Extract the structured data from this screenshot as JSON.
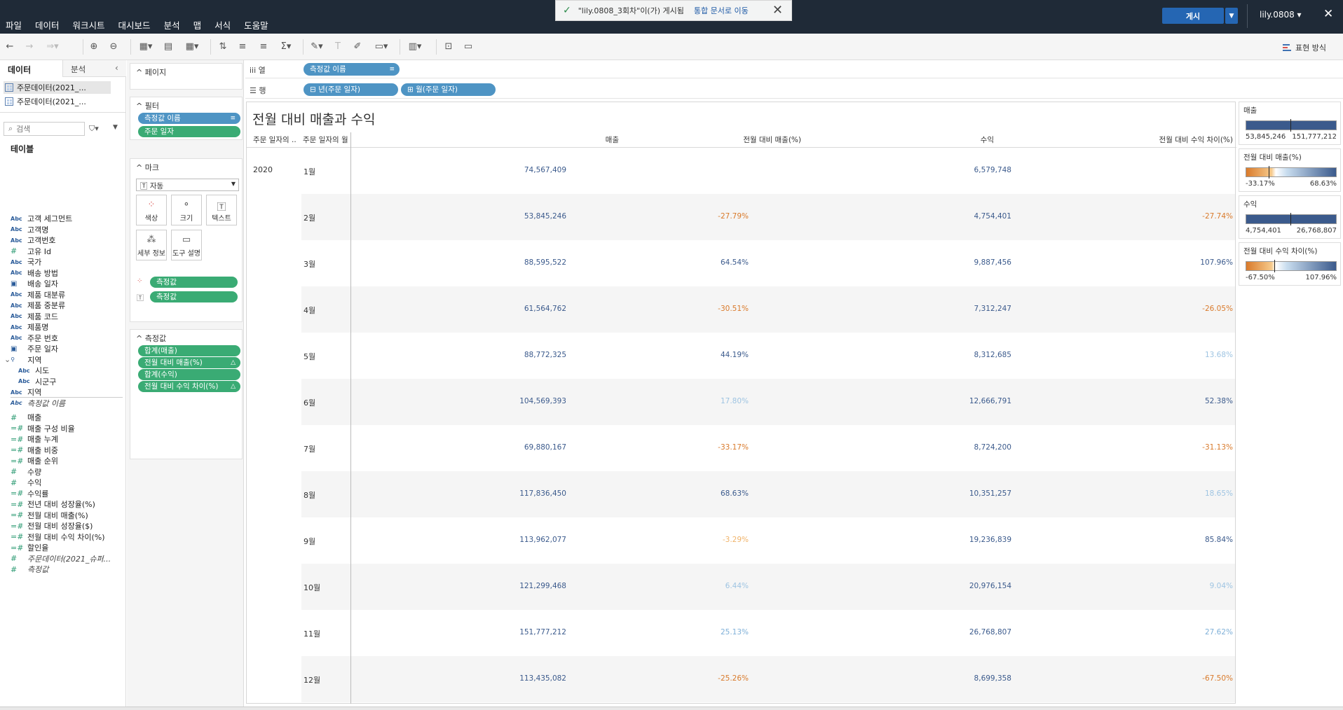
{
  "menu": [
    "파일",
    "데이터",
    "워크시트",
    "대시보드",
    "분석",
    "맵",
    "서식",
    "도움말"
  ],
  "toast": {
    "message": "\"lily.0808_3회차\"이(가) 게시됨",
    "link": "통합 문서로 이동"
  },
  "publish_label": "게시",
  "user": "lily.0808 ▾",
  "show_me": "표현 방식",
  "data_pane": {
    "tab_data": "데이터",
    "tab_analysis": "분석",
    "datasources": [
      "주문데이터(2021_...",
      "주문데이터(2021_..."
    ],
    "search_placeholder": "검색",
    "tables_heading": "테이블",
    "dimensions": [
      {
        "icon": "Abc",
        "name": "고객 세그먼트"
      },
      {
        "icon": "Abc",
        "name": "고객명"
      },
      {
        "icon": "Abc",
        "name": "고객번호"
      },
      {
        "icon": "#",
        "name": "고유 Id"
      },
      {
        "icon": "Abc",
        "name": "국가"
      },
      {
        "icon": "Abc",
        "name": "배송 방법"
      },
      {
        "icon": "cal",
        "name": "배송 일자"
      },
      {
        "icon": "Abc",
        "name": "제품 대분류"
      },
      {
        "icon": "Abc",
        "name": "제품 중분류"
      },
      {
        "icon": "Abc",
        "name": "제품 코드"
      },
      {
        "icon": "Abc",
        "name": "제품명"
      },
      {
        "icon": "Abc",
        "name": "주문 번호"
      },
      {
        "icon": "cal",
        "name": "주문 일자"
      }
    ],
    "hierarchy": "지역",
    "hierarchy_children": [
      "시도",
      "시군구"
    ],
    "dimensions_after": [
      {
        "icon": "Abc",
        "name": "지역"
      },
      {
        "icon": "Abc",
        "name": "측정값 이름"
      }
    ],
    "measures": [
      {
        "icon": "#",
        "name": "매출"
      },
      {
        "icon": "=#",
        "name": "매출 구성 비율"
      },
      {
        "icon": "=#",
        "name": "매출 누계"
      },
      {
        "icon": "=#",
        "name": "매출 비중"
      },
      {
        "icon": "=#",
        "name": "매출 순위"
      },
      {
        "icon": "#",
        "name": "수량"
      },
      {
        "icon": "#",
        "name": "수익"
      },
      {
        "icon": "=#",
        "name": "수익률"
      },
      {
        "icon": "=#",
        "name": "전년 대비 성장율(%)"
      },
      {
        "icon": "=#",
        "name": "전월 대비 매출(%)"
      },
      {
        "icon": "=#",
        "name": "전월 대비 성장율($)"
      },
      {
        "icon": "=#",
        "name": "전월 대비 수익 차이(%)"
      },
      {
        "icon": "=#",
        "name": "할인율"
      },
      {
        "icon": "#",
        "name": "주문데이터(2021_슈퍼..."
      },
      {
        "icon": "#",
        "name": "측정값"
      }
    ]
  },
  "shelves": {
    "pages": "페이지",
    "filters": "필터",
    "filter_pills": [
      "측정값 이름",
      "주문 일자"
    ],
    "marks": "마크",
    "mark_type": "자동",
    "mark_buttons": [
      "색상",
      "크기",
      "텍스트",
      "세부 정보",
      "도구 설명"
    ],
    "mark_pills": [
      "측정값",
      "측정값"
    ],
    "measure_values": "측정값",
    "measure_pills": [
      "합계(매출)",
      "전월 대비 매출(%)",
      "합계(수익)",
      "전월 대비 수익 차이(%)"
    ],
    "columns_label": "열",
    "rows_label": "행",
    "column_pill": "측정값 이름",
    "row_pills": [
      "⊟ 년(주문 일자)",
      "⊞ 월(주문 일자)"
    ]
  },
  "view": {
    "title": "전월 대비 매출과 수익",
    "headers": [
      "주문 일자의 ..",
      "주문 일자의 월",
      "매출",
      "전월 대비 매출(%)",
      "수익",
      "전월 대비 수익 차이(%)"
    ],
    "year": "2020",
    "rows": [
      {
        "month": "1월",
        "sales": "74,567,409",
        "mom_sales": "",
        "profit": "6,579,748",
        "mom_profit": ""
      },
      {
        "month": "2월",
        "sales": "53,845,246",
        "mom_sales": "-27.79%",
        "profit": "4,754,401",
        "mom_profit": "-27.74%"
      },
      {
        "month": "3월",
        "sales": "88,595,522",
        "mom_sales": "64.54%",
        "profit": "9,887,456",
        "mom_profit": "107.96%"
      },
      {
        "month": "4월",
        "sales": "61,564,762",
        "mom_sales": "-30.51%",
        "profit": "7,312,247",
        "mom_profit": "-26.05%"
      },
      {
        "month": "5월",
        "sales": "88,772,325",
        "mom_sales": "44.19%",
        "profit": "8,312,685",
        "mom_profit": "13.68%"
      },
      {
        "month": "6월",
        "sales": "104,569,393",
        "mom_sales": "17.80%",
        "profit": "12,666,791",
        "mom_profit": "52.38%"
      },
      {
        "month": "7월",
        "sales": "69,880,167",
        "mom_sales": "-33.17%",
        "profit": "8,724,200",
        "mom_profit": "-31.13%"
      },
      {
        "month": "8월",
        "sales": "117,836,450",
        "mom_sales": "68.63%",
        "profit": "10,351,257",
        "mom_profit": "18.65%"
      },
      {
        "month": "9월",
        "sales": "113,962,077",
        "mom_sales": "-3.29%",
        "profit": "19,236,839",
        "mom_profit": "85.84%"
      },
      {
        "month": "10월",
        "sales": "121,299,468",
        "mom_sales": "6.44%",
        "profit": "20,976,154",
        "mom_profit": "9.04%"
      },
      {
        "month": "11월",
        "sales": "151,777,212",
        "mom_sales": "25.13%",
        "profit": "26,768,807",
        "mom_profit": "27.62%"
      },
      {
        "month": "12월",
        "sales": "113,435,082",
        "mom_sales": "-25.26%",
        "profit": "8,699,358",
        "mom_profit": "-67.50%"
      }
    ]
  },
  "legends": [
    {
      "title": "매출",
      "min": "53,845,246",
      "max": "151,777,212",
      "type": "blue"
    },
    {
      "title": "전월 대비 매출(%)",
      "min": "-33.17%",
      "max": "68.63%",
      "type": "diverging"
    },
    {
      "title": "수익",
      "min": "4,754,401",
      "max": "26,768,807",
      "type": "blue"
    },
    {
      "title": "전월 대비 수익 차이(%)",
      "min": "-67.50%",
      "max": "107.96%",
      "type": "diverging"
    }
  ],
  "colors": {
    "blue_dark": "#3b5a8c",
    "orange": "#d97a2b",
    "light_blue": "#7fb0d8",
    "pill_blue": "#4e94c4",
    "pill_green": "#3aab74"
  }
}
